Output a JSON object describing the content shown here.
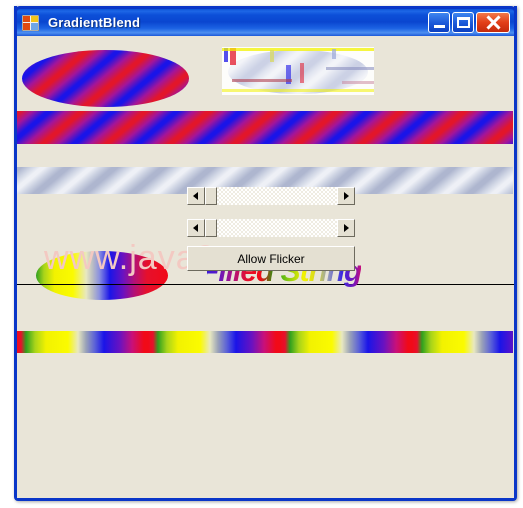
{
  "window": {
    "title": "GradientBlend",
    "icon": "form-designer-icon",
    "controls": {
      "minimize_label": "Minimize",
      "maximize_label": "Maximize",
      "close_label": "Close"
    },
    "frame_color": "#0a36c8",
    "titlebar_color": "#0a46d0",
    "client_color": "#e9e5d8"
  },
  "watermark": {
    "text": "www.java2s.com",
    "color": "#f3c9c2"
  },
  "canvas": {
    "hatch_ellipse": {
      "name": "Red/blue diagonal gradient-hatch ellipse",
      "colors": [
        "#e2162a",
        "#a3159a",
        "#1a14e8"
      ]
    },
    "faded_image": {
      "name": "Faded blended bitmap of hatched ellipse",
      "colors": [
        "#c9cfe4",
        "#f2f3f8",
        "#aeb6cf"
      ]
    },
    "bar_vivid": {
      "name": "Vivid red/blue diagonal gradient bar",
      "colors": [
        "#e2162a",
        "#1a14e8"
      ]
    },
    "bar_faded": {
      "name": "Faded gray/blue diagonal gradient bar",
      "colors": [
        "#aeb6cf",
        "#eef0f6"
      ]
    },
    "rainbow_ellipse": {
      "name": "Rainbow multi-stop gradient ellipse",
      "colors": [
        "#2f9f1f",
        "#f2f200",
        "#b9bcc4",
        "#1a14e8",
        "#b0107a",
        "#f10a18"
      ]
    },
    "filled_string": {
      "text": "Filled String",
      "name": "Gradient-filled italic bold text",
      "colors": [
        "#2a1ae0",
        "#e6102c",
        "#1f9f12",
        "#f2f200",
        "#c8107a"
      ]
    },
    "bar_rainbow": {
      "name": "Repeating rainbow gradient bar",
      "colors": [
        "#f10a18",
        "#2f9f1f",
        "#f2f200",
        "#1a14e8",
        "#c8107a"
      ]
    },
    "baseline": {
      "name": "Black baseline rule",
      "color": "#000000"
    }
  },
  "controls": {
    "scrollbar_top": {
      "name": "hscrollbar-top",
      "value": 0,
      "minimum": 0,
      "maximum": 100,
      "left_arrow": "◄",
      "right_arrow": "►"
    },
    "scrollbar_bottom": {
      "name": "hscrollbar-bottom",
      "value": 0,
      "minimum": 0,
      "maximum": 100,
      "left_arrow": "◄",
      "right_arrow": "►"
    },
    "allow_flicker_button": {
      "label": "Allow Flicker"
    }
  }
}
